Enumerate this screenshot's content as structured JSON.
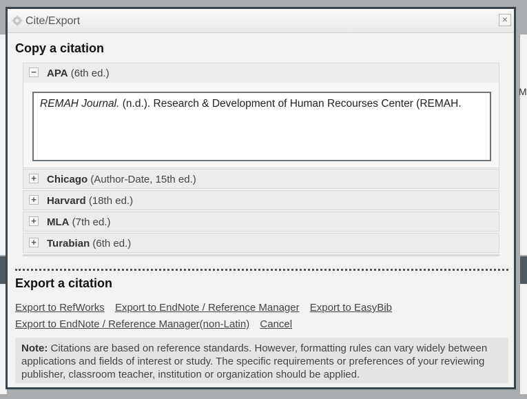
{
  "background": {
    "fragment_right": "M/"
  },
  "dialog": {
    "title": "Cite/Export",
    "close_glyph": "×",
    "copy_heading": "Copy a citation",
    "styles": [
      {
        "name": "APA",
        "detail": "(6th ed.)",
        "toggle": "−",
        "expanded": true
      },
      {
        "name": "Chicago",
        "detail": "(Author-Date, 15th ed.)",
        "toggle": "+",
        "expanded": false
      },
      {
        "name": "Harvard",
        "detail": "(18th ed.)",
        "toggle": "+",
        "expanded": false
      },
      {
        "name": "MLA",
        "detail": "(7th ed.)",
        "toggle": "+",
        "expanded": false
      },
      {
        "name": "Turabian",
        "detail": "(6th ed.)",
        "toggle": "+",
        "expanded": false
      }
    ],
    "citation": {
      "journal": "REMAH Journal.",
      "rest": " (n.d.). Research & Development of Human Recourses Center (REMAH."
    },
    "export_heading": "Export a citation",
    "export_links": [
      "Export to RefWorks",
      "Export to EndNote / Reference Manager",
      "Export to EasyBib",
      "Export to EndNote / Reference Manager(non-Latin)",
      "Cancel"
    ],
    "note": {
      "label": "Note:",
      "text": " Citations are based on reference standards. However, formatting rules can vary widely between applications and fields of interest or study. The specific requirements or preferences of your reviewing publisher, classroom teacher, institution or organization should be applied."
    },
    "icons": {
      "title": "gear-icon",
      "close": "close-icon"
    },
    "colors": {
      "border": "#39454d",
      "link": "#444444",
      "note_bg": "#e2e4e5"
    }
  }
}
